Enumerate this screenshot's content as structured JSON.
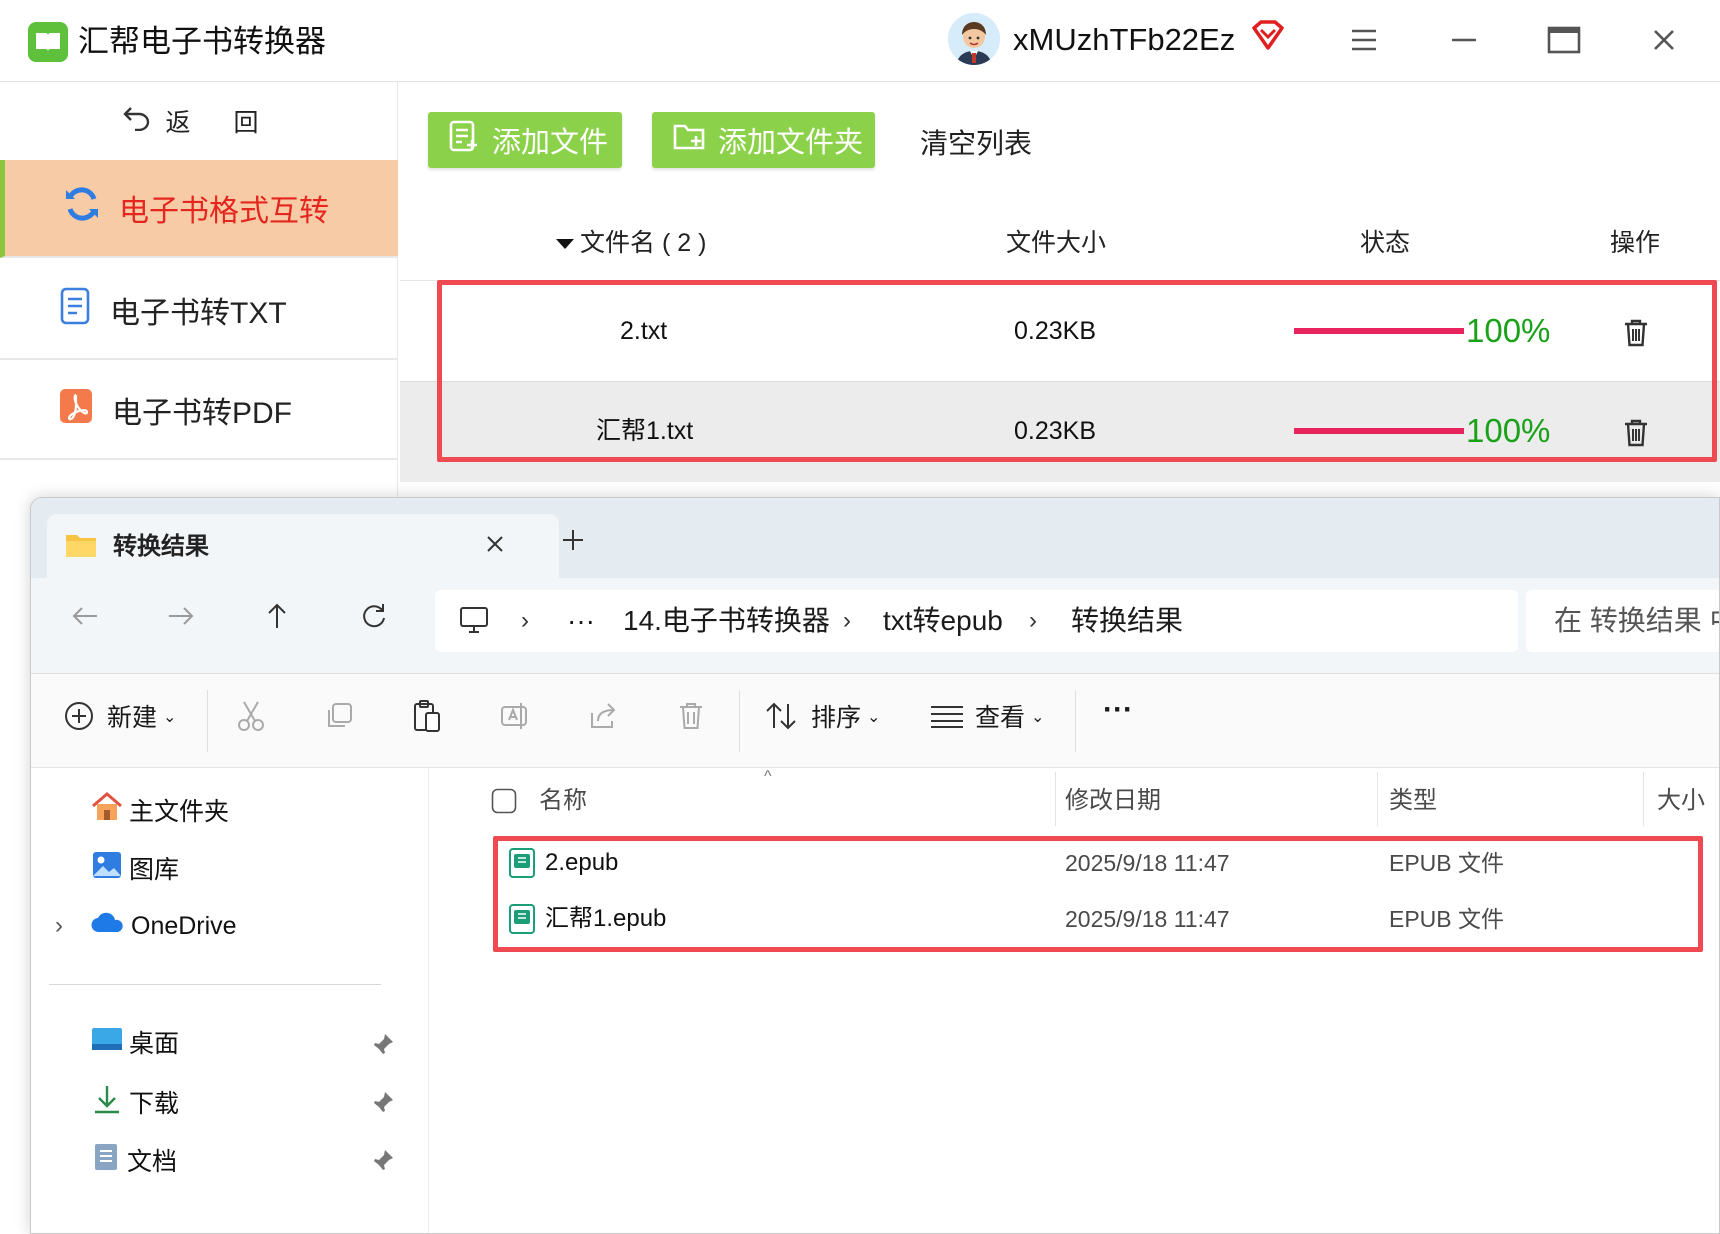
{
  "app": {
    "title": "汇帮电子书转换器",
    "username": "xMUzhTFb22Ez",
    "back_label": "返 回",
    "nav": [
      {
        "label": "电子书格式互转",
        "active": true
      },
      {
        "label": "电子书转TXT",
        "active": false
      },
      {
        "label": "电子书转PDF",
        "active": false
      }
    ],
    "toolbar": {
      "add_file": "添加文件",
      "add_folder": "添加文件夹",
      "clear_list": "清空列表"
    },
    "table": {
      "headers": {
        "name": "文件名 ( 2 )",
        "size": "文件大小",
        "status": "状态",
        "action": "操作"
      },
      "rows": [
        {
          "name": "2.txt",
          "size": "0.23KB",
          "progress": "100%"
        },
        {
          "name": "汇帮1.txt",
          "size": "0.23KB",
          "progress": "100%"
        }
      ]
    },
    "colors": {
      "accent_green": "#8cd14a",
      "active_bg": "#f8cba7",
      "active_text": "#e5261f",
      "progress": "#e8245e",
      "percent": "#19a219",
      "highlight": "#ef4a52"
    }
  },
  "explorer": {
    "tab_title": "转换结果",
    "breadcrumb": [
      "14.电子书转换器",
      "txt转epub",
      "转换结果"
    ],
    "ellipsis": "···",
    "search_placeholder": "在 转换结果 中",
    "commands": {
      "new": "新建",
      "sort": "排序",
      "view": "查看",
      "more": "···"
    },
    "tree": {
      "home": "主文件夹",
      "gallery": "图库",
      "onedrive": "OneDrive",
      "desktop": "桌面",
      "downloads": "下载",
      "documents": "文档"
    },
    "columns": {
      "name": "名称",
      "modified": "修改日期",
      "type": "类型",
      "size": "大小"
    },
    "files": [
      {
        "name": "2.epub",
        "modified": "2025/9/18 11:47",
        "type": "EPUB 文件"
      },
      {
        "name": "汇帮1.epub",
        "modified": "2025/9/18 11:47",
        "type": "EPUB 文件"
      }
    ]
  }
}
